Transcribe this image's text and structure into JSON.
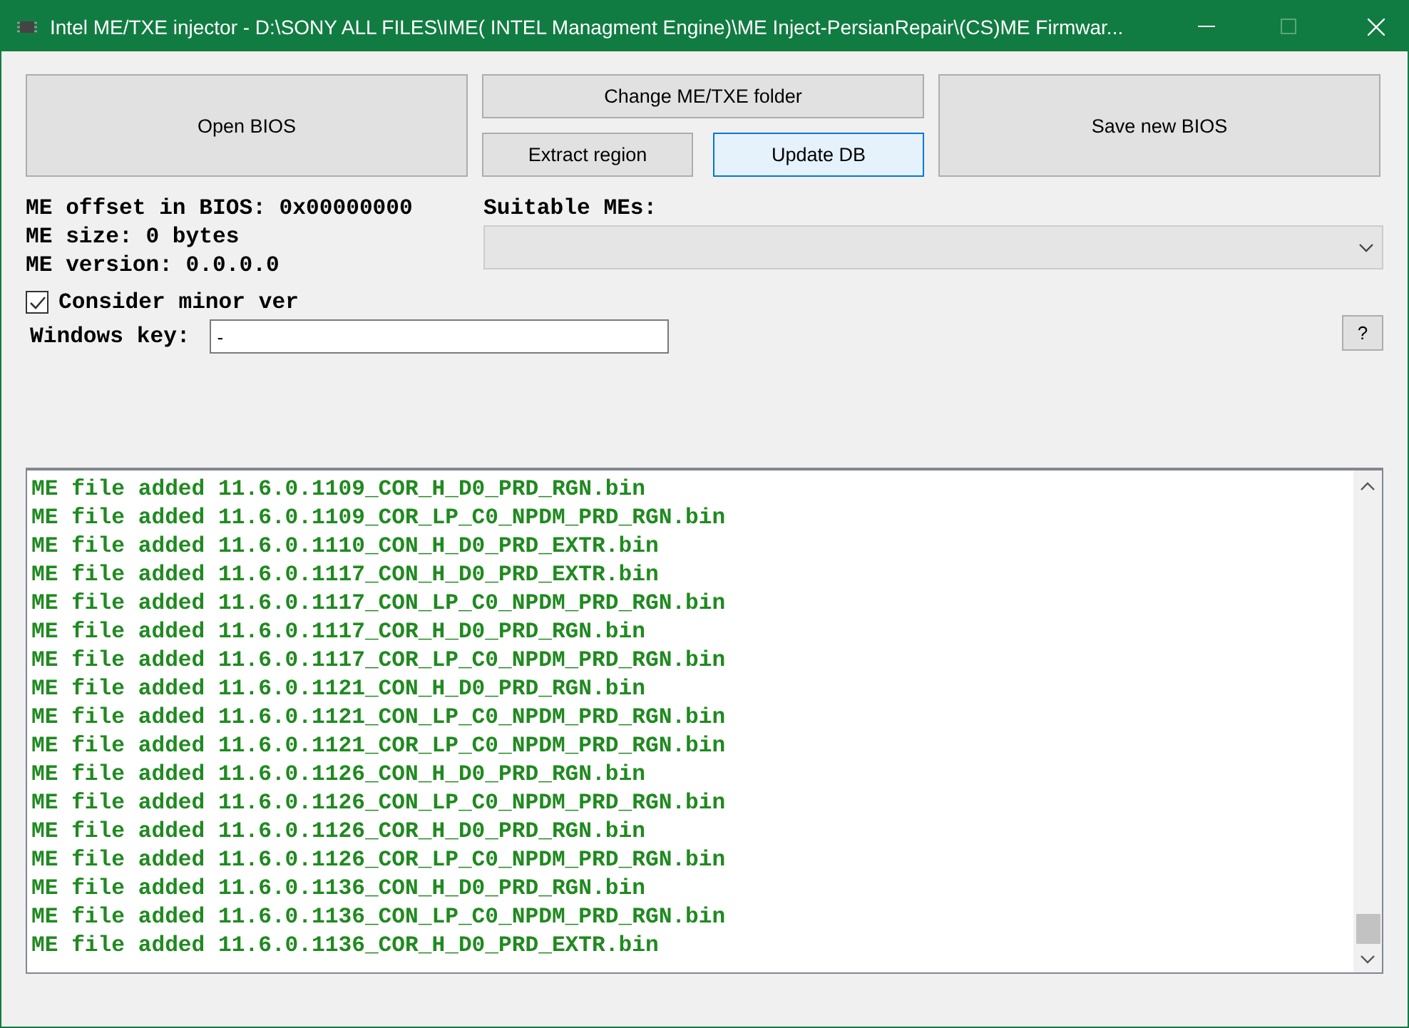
{
  "window": {
    "title": "Intel ME/TXE injector - D:\\SONY ALL FILES\\IME( INTEL Managment Engine)\\ME Inject-PersianRepair\\(CS)ME Firmwar..."
  },
  "buttons": {
    "open_bios": {
      "label": "Open BIOS",
      "focused": false
    },
    "change_folder": {
      "label": "Change ME/TXE folder",
      "focused": false
    },
    "extract_region": {
      "label": "Extract region",
      "focused": false
    },
    "update_db": {
      "label": "Update DB",
      "focused": true
    },
    "save_bios": {
      "label": "Save new BIOS",
      "focused": false
    }
  },
  "info": [
    "ME offset in BIOS: 0x00000000",
    "ME size: 0 bytes",
    "ME version: 0.0.0.0"
  ],
  "suitable_mes": {
    "label": "Suitable MEs:",
    "disabled": true
  },
  "consider_minor": {
    "label": "Consider minor ver",
    "checked": true
  },
  "windows_key": {
    "label": "Windows key:",
    "value": "-"
  },
  "help_button": "?",
  "log": [
    "ME file added 11.6.0.1109_COR_H_D0_PRD_RGN.bin",
    "ME file added 11.6.0.1109_COR_LP_C0_NPDM_PRD_RGN.bin",
    "ME file added 11.6.0.1110_CON_H_D0_PRD_EXTR.bin",
    "ME file added 11.6.0.1117_CON_H_D0_PRD_EXTR.bin",
    "ME file added 11.6.0.1117_CON_LP_C0_NPDM_PRD_RGN.bin",
    "ME file added 11.6.0.1117_COR_H_D0_PRD_RGN.bin",
    "ME file added 11.6.0.1117_COR_LP_C0_NPDM_PRD_RGN.bin",
    "ME file added 11.6.0.1121_CON_H_D0_PRD_RGN.bin",
    "ME file added 11.6.0.1121_CON_LP_C0_NPDM_PRD_RGN.bin",
    "ME file added 11.6.0.1121_COR_LP_C0_NPDM_PRD_RGN.bin",
    "ME file added 11.6.0.1126_CON_H_D0_PRD_RGN.bin",
    "ME file added 11.6.0.1126_CON_LP_C0_NPDM_PRD_RGN.bin",
    "ME file added 11.6.0.1126_COR_H_D0_PRD_RGN.bin",
    "ME file added 11.6.0.1126_COR_LP_C0_NPDM_PRD_RGN.bin",
    "ME file added 11.6.0.1136_CON_H_D0_PRD_RGN.bin",
    "ME file added 11.6.0.1136_CON_LP_C0_NPDM_PRD_RGN.bin",
    "ME file added 11.6.0.1136_COR_H_D0_PRD_EXTR.bin"
  ]
}
